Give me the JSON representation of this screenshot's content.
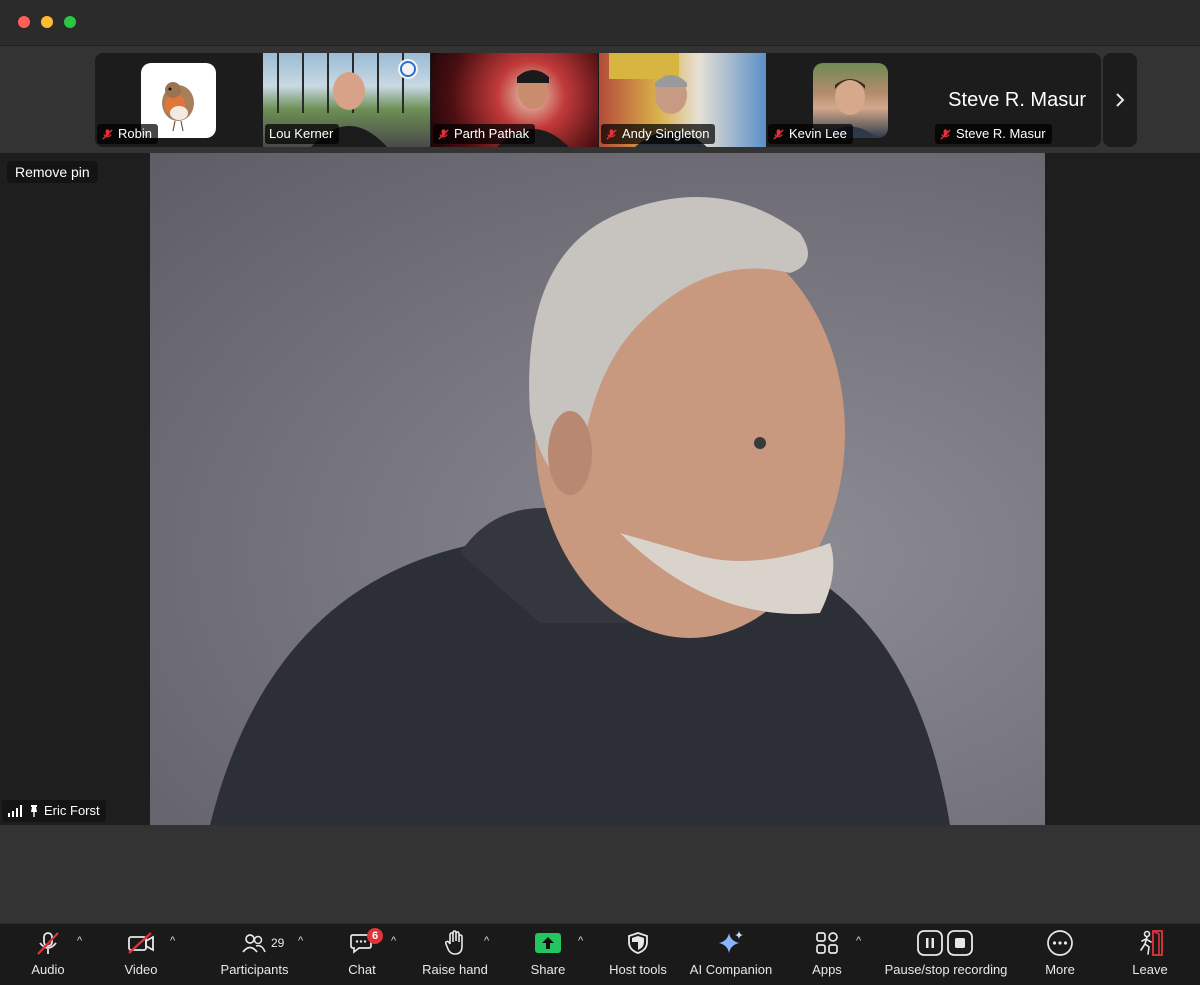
{
  "participants_strip": [
    {
      "name": "Robin",
      "muted": true
    },
    {
      "name": "Lou Kerner",
      "muted": false
    },
    {
      "name": "Parth Pathak",
      "muted": true
    },
    {
      "name": "Andy Singleton",
      "muted": true
    },
    {
      "name": "Kevin Lee",
      "muted": true
    },
    {
      "name": "Steve R. Masur",
      "muted": true
    }
  ],
  "steve_big_name": "Steve R. Masur",
  "main": {
    "remove_pin": "Remove pin",
    "speaker_name": "Eric Forst"
  },
  "toolbar": {
    "audio": "Audio",
    "video": "Video",
    "participants": "Participants",
    "participants_count": "29",
    "chat": "Chat",
    "chat_badge": "6",
    "raise_hand": "Raise hand",
    "share": "Share",
    "host_tools": "Host tools",
    "ai_companion": "AI Companion",
    "apps": "Apps",
    "pause_stop": "Pause/stop recording",
    "more": "More",
    "leave": "Leave"
  },
  "colors": {
    "muted_red": "#e0343b",
    "share_green": "#22c55e",
    "leave_red": "#e0343b",
    "ai_blue": "#8ab4ff"
  }
}
